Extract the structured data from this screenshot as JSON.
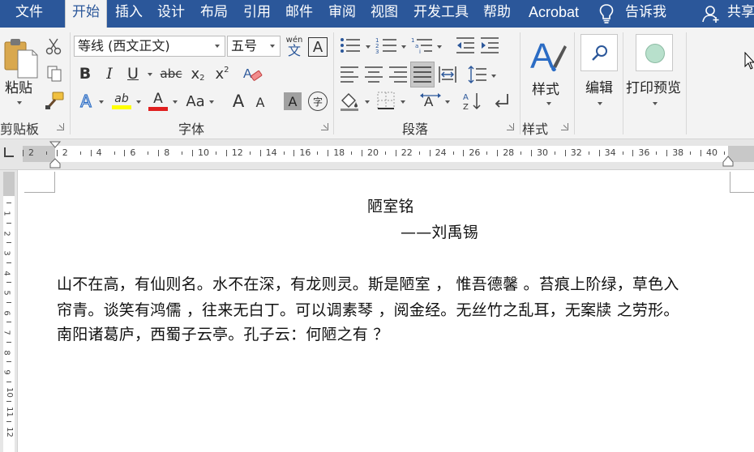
{
  "menu": {
    "tabs": [
      "文件",
      "开始",
      "插入",
      "设计",
      "布局",
      "引用",
      "邮件",
      "审阅",
      "视图",
      "开发工具",
      "帮助",
      "Acrobat"
    ],
    "active_tab": "开始",
    "tell_me": "告诉我",
    "share": "共享"
  },
  "ribbon": {
    "clipboard": {
      "paste_label": "粘贴",
      "group_label": "剪贴板"
    },
    "font": {
      "font_name": "等线 (西文正文)",
      "font_size": "五号",
      "phonetic_top": "wén",
      "phonetic_bottom": "文",
      "char_border": "A",
      "bold": "B",
      "italic": "I",
      "underline": "U",
      "strikethrough": "abc",
      "subscript": "x",
      "subscript_mark": "2",
      "superscript": "x",
      "superscript_mark": "2",
      "text_effect": "A",
      "highlight": "ab",
      "font_color": "A",
      "change_case": "Aa",
      "grow_font": "A",
      "shrink_font": "A",
      "char_shading": "A",
      "enclose_char": "字",
      "group_label": "字体",
      "highlight_color": "#ffff00",
      "font_color_bar": "#e02020"
    },
    "paragraph": {
      "group_label": "段落"
    },
    "styles": {
      "styles_label": "样式",
      "group_label": "样式"
    },
    "editing": {
      "label": "编辑"
    },
    "print_preview": {
      "label": "打印预览"
    }
  },
  "ruler": {
    "numbers": [
      "2",
      "2",
      "4",
      "6",
      "8",
      "10",
      "12",
      "14",
      "16",
      "18",
      "20",
      "22",
      "24",
      "26",
      "28",
      "30",
      "32",
      "34",
      "36",
      "38",
      "40"
    ],
    "vertical_numbers": [
      "1",
      "2",
      "3",
      "4",
      "5",
      "6",
      "7",
      "8",
      "9",
      "10",
      "11",
      "12"
    ]
  },
  "document": {
    "title": "陋室铭",
    "author": "——刘禹锡",
    "lines": [
      "山不在高，有仙则名。水不在深，有龙则灵。斯是陋室 ， 惟吾德馨 。苔痕上阶绿，草色入",
      "帘青。谈笑有鸿儒 ，往来无白丁。可以调素琴 ，阅金经。无丝竹之乱耳，无案牍 之劳形。",
      "南阳诸葛庐，西蜀子云亭。孔子云：何陋之有 ？"
    ]
  },
  "colors": {
    "menubar": "#2b579a",
    "ribbon": "#f3f3f3",
    "accent_blue": "#2b579a"
  }
}
